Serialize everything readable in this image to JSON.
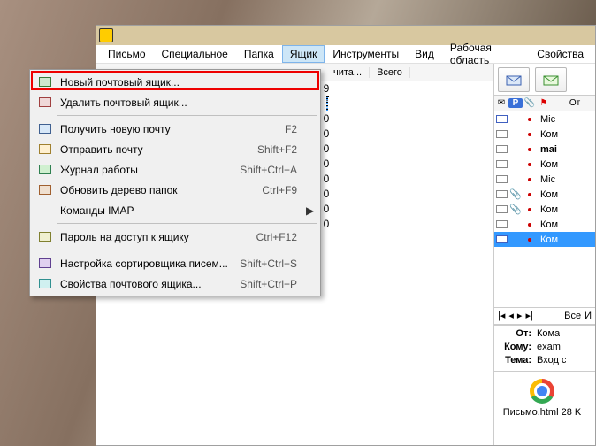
{
  "menubar": [
    "Письмо",
    "Специальное",
    "Папка",
    "Ящик",
    "Инструменты",
    "Вид",
    "Рабочая область",
    "Свойства"
  ],
  "menubar_active_index": 3,
  "dropdown": [
    {
      "icon": "mi-new",
      "label": "Новый почтовый ящик...",
      "shortcut": "",
      "arrow": false
    },
    {
      "icon": "mi-del",
      "label": "Удалить почтовый ящик...",
      "shortcut": "",
      "arrow": false
    },
    {
      "sep": true
    },
    {
      "icon": "mi-get",
      "label": "Получить новую почту",
      "shortcut": "F2",
      "arrow": false
    },
    {
      "icon": "mi-snd",
      "label": "Отправить почту",
      "shortcut": "Shift+F2",
      "arrow": false
    },
    {
      "icon": "mi-jrn",
      "label": "Журнал работы",
      "shortcut": "Shift+Ctrl+A",
      "arrow": false
    },
    {
      "icon": "mi-ref",
      "label": "Обновить дерево папок",
      "shortcut": "Ctrl+F9",
      "arrow": false
    },
    {
      "icon": "",
      "label": "Команды IMAP",
      "shortcut": "",
      "arrow": true
    },
    {
      "sep": true
    },
    {
      "icon": "mi-key",
      "label": "Пароль на доступ к ящику",
      "shortcut": "Ctrl+F12",
      "arrow": false
    },
    {
      "sep": true
    },
    {
      "icon": "mi-srt",
      "label": "Настройка сортировщика писем...",
      "shortcut": "Shift+Ctrl+S",
      "arrow": false
    },
    {
      "icon": "mi-prp",
      "label": "Свойства почтового ящика...",
      "shortcut": "Shift+Ctrl+P",
      "arrow": false
    }
  ],
  "col_headers": {
    "read": "чита...",
    "total": "Всего"
  },
  "num_rows": [
    "9",
    "9",
    "0",
    "0",
    "0",
    "0",
    "0",
    "0",
    "0",
    "0"
  ],
  "num_selected_index": 1,
  "msg_header": {
    "from": "От"
  },
  "messages": [
    {
      "type": "closed",
      "clip": false,
      "from": "Mic"
    },
    {
      "type": "open",
      "clip": false,
      "from": "Ком"
    },
    {
      "type": "open",
      "clip": false,
      "from": "mai",
      "bold": true
    },
    {
      "type": "open",
      "clip": false,
      "from": "Ком"
    },
    {
      "type": "open",
      "clip": false,
      "from": "Mic"
    },
    {
      "type": "open",
      "clip": true,
      "from": "Ком"
    },
    {
      "type": "open",
      "clip": true,
      "from": "Ком"
    },
    {
      "type": "open",
      "clip": false,
      "from": "Ком"
    },
    {
      "type": "closed",
      "clip": false,
      "from": "Ком",
      "sel": true
    }
  ],
  "nav": {
    "all": "Все",
    "and": "И"
  },
  "info": {
    "from_lbl": "От:",
    "from_val": "Кома",
    "to_lbl": "Кому:",
    "to_val": "exam",
    "subj_lbl": "Тема:",
    "subj_val": "Вход с"
  },
  "attachment": {
    "name": "Письмо.html",
    "size": "28 K"
  }
}
